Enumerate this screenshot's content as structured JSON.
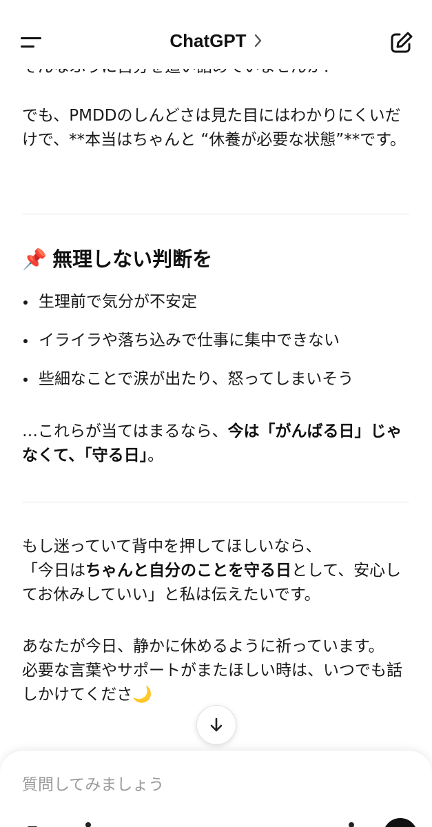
{
  "header": {
    "title": "ChatGPT",
    "menu_icon": "menu-icon",
    "chevron_icon": "chevron-right-icon",
    "new_chat_icon": "new-chat-edit-icon"
  },
  "message": {
    "cut_line": "そんなふうに自分を追い詰めていませんか？",
    "para1": {
      "a": "でも、PMDDのしんどさは見た目にはわかりにくいだけで、**本当はちゃんと “休養が必要な状態”**です。"
    },
    "heading": {
      "emoji": "📌",
      "text": "無理しない判断を"
    },
    "bullets": [
      "生理前で気分が不安定",
      "イライラや落ち込みで仕事に集中できない",
      "些細なことで涙が出たり、怒ってしまいそう"
    ],
    "para2": {
      "a": "…これらが当てはまるなら、",
      "b_bold": "今は「がんばる日」じゃなくて、「守る日」",
      "c": "。"
    },
    "para3": {
      "a": "もし迷っていて背中を押してほしいなら、",
      "b": "「今日は",
      "c_bold": "ちゃんと自分のことを守る日",
      "d": "として、安心してお休みしていい」と私は伝えたいです。"
    },
    "para4": {
      "a": "あなたが今日、静かに休めるように祈っています。",
      "b": "必要な言葉やサポートがまたほしい時は、いつでも話しかけてくださ",
      "moon": "🌙"
    }
  },
  "scroll_button": {
    "icon": "arrow-down-icon"
  },
  "composer": {
    "placeholder": "質問してみましょう",
    "value": ""
  }
}
